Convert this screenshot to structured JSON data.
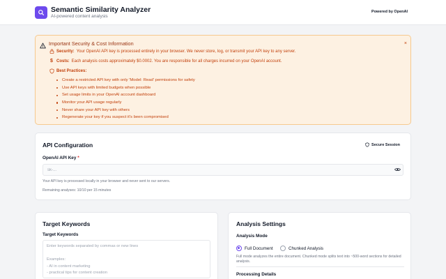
{
  "header": {
    "title": "Semantic Similarity Analyzer",
    "subtitle": "AI-powered content analysis",
    "powered_by": "Powered by OpenAI",
    "logo_icon": "search-icon",
    "logo_color": "#6d4aed"
  },
  "warning": {
    "title": "Important Security & Cost Information",
    "close_label": "×",
    "security_label": "Security:",
    "security_text": "Your OpenAI API key is processed entirely in your browser. We never store, log, or transmit your API key to any server.",
    "costs_label": "Costs:",
    "costs_text": "Each analysis costs approximately $0.0002. You are responsible for all charges incurred on your OpenAI account.",
    "practices_label": "Best Practices:",
    "practices": [
      "Create a restricted API key with only 'Model: Read' permissions for safety",
      "Use API keys with limited budgets when possible",
      "Set usage limits in your OpenAI account dashboard",
      "Monitor your API usage regularly",
      "Never share your API key with others",
      "Regenerate your key if you suspect it's been compromised"
    ],
    "colors": {
      "background": "#fdf1e2",
      "border": "#f6c98e",
      "text": "#c2410c",
      "title": "#9a3412"
    }
  },
  "api_config": {
    "title": "API Configuration",
    "secure_session": "Secure Session",
    "key_label": "OpenAI API Key",
    "required_mark": "*",
    "key_placeholder": "sk-...",
    "key_value": "",
    "help_text": "Your API key is processed locally in your browser and never sent to our servers.",
    "remaining": "Remaining analyses: 10/10 per 15 minutes"
  },
  "keywords": {
    "title": "Target Keywords",
    "field_label": "Target Keywords",
    "placeholder": "Enter keywords separated by commas or new lines\n\nExamples:\n- AI in content marketing\n- practical tips for content creation\n- content marketing automation"
  },
  "settings": {
    "title": "Analysis Settings",
    "mode_label": "Analysis Mode",
    "options": [
      {
        "label": "Full Document",
        "selected": true
      },
      {
        "label": "Chunked Analysis",
        "selected": false
      }
    ],
    "mode_description": "Full mode analyzes the entire document. Chunked mode splits text into ~500-word sections for detailed analysis.",
    "processing_label": "Processing Details"
  }
}
